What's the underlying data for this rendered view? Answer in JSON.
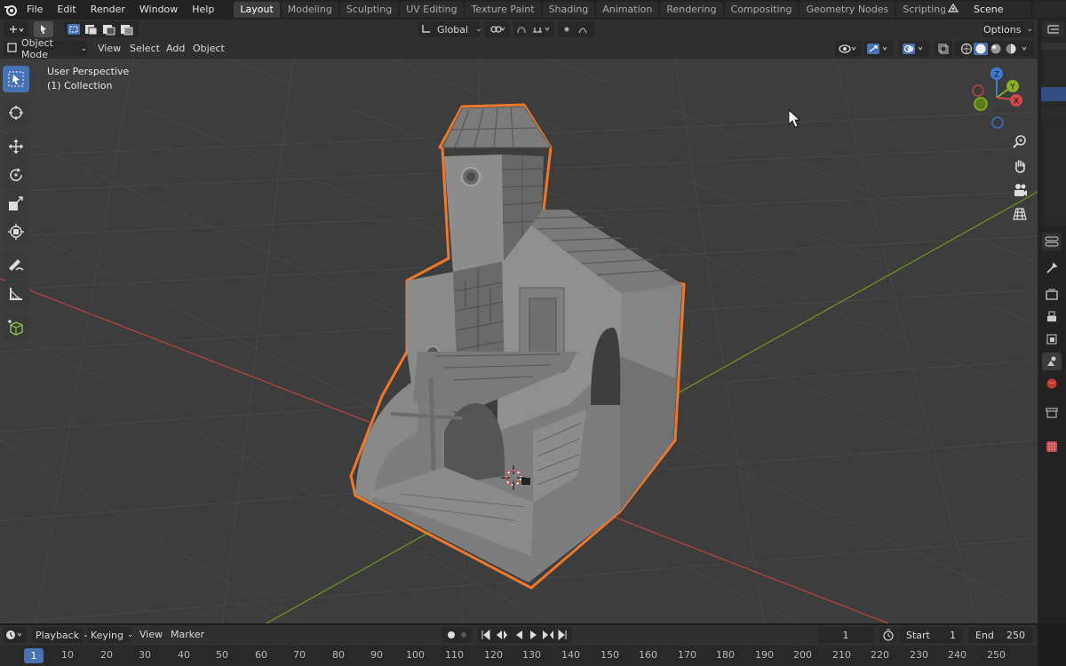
{
  "menu": {
    "items": [
      "File",
      "Edit",
      "Render",
      "Window",
      "Help"
    ]
  },
  "workspaces": {
    "tabs": [
      "Layout",
      "Modeling",
      "Sculpting",
      "UV Editing",
      "Texture Paint",
      "Shading",
      "Animation",
      "Rendering",
      "Compositing",
      "Geometry Nodes",
      "Scripting"
    ],
    "active": "Layout",
    "add_label": "+"
  },
  "scene": {
    "label": "Scene"
  },
  "header": {
    "transform_orientation": "Global",
    "options_label": "Options"
  },
  "viewport_header": {
    "mode": "Object Mode",
    "menus": [
      "View",
      "Select",
      "Add",
      "Object"
    ]
  },
  "viewport": {
    "perspective_label": "User Perspective",
    "collection_label": "(1) Collection",
    "gizmo": {
      "z": "Z",
      "y": "Y",
      "x": "X"
    }
  },
  "timeline": {
    "menus": [
      "Playback",
      "Keying",
      "View",
      "Marker"
    ],
    "current_frame": "1",
    "start_label": "Start",
    "start_value": "1",
    "end_label": "End",
    "end_value": "250",
    "ruler_ticks": [
      "10",
      "20",
      "30",
      "40",
      "50",
      "60",
      "70",
      "80",
      "90",
      "100",
      "110",
      "120",
      "130",
      "140",
      "150",
      "160",
      "170",
      "180",
      "190",
      "200",
      "210",
      "220",
      "230",
      "240",
      "250"
    ],
    "ruler_current": "1"
  },
  "colors": {
    "accent": "#4772b3",
    "selection_outline": "#f0782a",
    "axis_x": "#c2484b",
    "axis_y": "#7f9a2e"
  }
}
